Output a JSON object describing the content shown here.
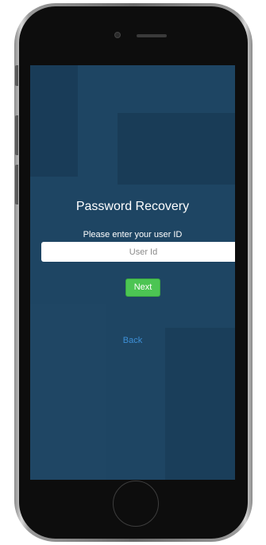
{
  "screen": {
    "title": "Password Recovery",
    "prompt": "Please enter your user ID",
    "user_id_field": {
      "value": "",
      "placeholder": "User Id"
    },
    "next_label": "Next",
    "back_label": "Back"
  },
  "colors": {
    "background": "#1e4563",
    "next_button": "#4cc553",
    "back_link": "#3d8fd6",
    "text": "#ffffff"
  }
}
